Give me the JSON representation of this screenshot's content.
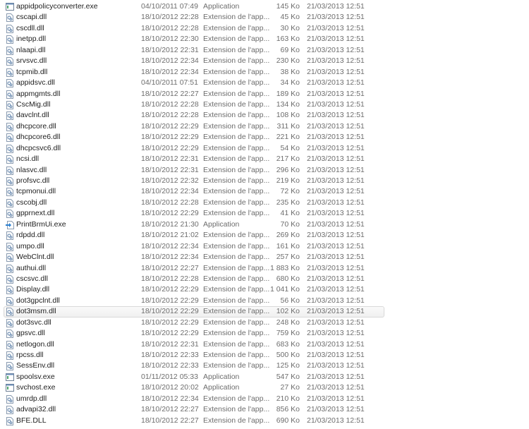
{
  "selected_index": 28,
  "files": [
    {
      "name": "appidpolicyconverter.exe",
      "date": "04/10/2011 07:49",
      "type": "Application",
      "size": "145 Ko",
      "modified": "21/03/2013 12:51",
      "icon": "exe-icon"
    },
    {
      "name": "cscapi.dll",
      "date": "18/10/2012 22:28",
      "type": "Extension de l'app...",
      "size": "45 Ko",
      "modified": "21/03/2013 12:51",
      "icon": "dll-icon"
    },
    {
      "name": "cscdll.dll",
      "date": "18/10/2012 22:28",
      "type": "Extension de l'app...",
      "size": "30 Ko",
      "modified": "21/03/2013 12:51",
      "icon": "dll-icon"
    },
    {
      "name": "inetpp.dll",
      "date": "18/10/2012 22:30",
      "type": "Extension de l'app...",
      "size": "163 Ko",
      "modified": "21/03/2013 12:51",
      "icon": "dll-icon"
    },
    {
      "name": "nlaapi.dll",
      "date": "18/10/2012 22:31",
      "type": "Extension de l'app...",
      "size": "69 Ko",
      "modified": "21/03/2013 12:51",
      "icon": "dll-icon"
    },
    {
      "name": "srvsvc.dll",
      "date": "18/10/2012 22:34",
      "type": "Extension de l'app...",
      "size": "230 Ko",
      "modified": "21/03/2013 12:51",
      "icon": "dll-icon"
    },
    {
      "name": "tcpmib.dll",
      "date": "18/10/2012 22:34",
      "type": "Extension de l'app...",
      "size": "38 Ko",
      "modified": "21/03/2013 12:51",
      "icon": "dll-icon"
    },
    {
      "name": "appidsvc.dll",
      "date": "04/10/2011 07:51",
      "type": "Extension de l'app...",
      "size": "34 Ko",
      "modified": "21/03/2013 12:51",
      "icon": "dll-icon"
    },
    {
      "name": "appmgmts.dll",
      "date": "18/10/2012 22:27",
      "type": "Extension de l'app...",
      "size": "189 Ko",
      "modified": "21/03/2013 12:51",
      "icon": "dll-icon"
    },
    {
      "name": "CscMig.dll",
      "date": "18/10/2012 22:28",
      "type": "Extension de l'app...",
      "size": "134 Ko",
      "modified": "21/03/2013 12:51",
      "icon": "dll-icon"
    },
    {
      "name": "davclnt.dll",
      "date": "18/10/2012 22:28",
      "type": "Extension de l'app...",
      "size": "108 Ko",
      "modified": "21/03/2013 12:51",
      "icon": "dll-icon"
    },
    {
      "name": "dhcpcore.dll",
      "date": "18/10/2012 22:29",
      "type": "Extension de l'app...",
      "size": "311 Ko",
      "modified": "21/03/2013 12:51",
      "icon": "dll-icon"
    },
    {
      "name": "dhcpcore6.dll",
      "date": "18/10/2012 22:29",
      "type": "Extension de l'app...",
      "size": "221 Ko",
      "modified": "21/03/2013 12:51",
      "icon": "dll-icon"
    },
    {
      "name": "dhcpcsvc6.dll",
      "date": "18/10/2012 22:29",
      "type": "Extension de l'app...",
      "size": "54 Ko",
      "modified": "21/03/2013 12:51",
      "icon": "dll-icon"
    },
    {
      "name": "ncsi.dll",
      "date": "18/10/2012 22:31",
      "type": "Extension de l'app...",
      "size": "217 Ko",
      "modified": "21/03/2013 12:51",
      "icon": "dll-icon"
    },
    {
      "name": "nlasvc.dll",
      "date": "18/10/2012 22:31",
      "type": "Extension de l'app...",
      "size": "296 Ko",
      "modified": "21/03/2013 12:51",
      "icon": "dll-icon"
    },
    {
      "name": "profsvc.dll",
      "date": "18/10/2012 22:32",
      "type": "Extension de l'app...",
      "size": "219 Ko",
      "modified": "21/03/2013 12:51",
      "icon": "dll-icon"
    },
    {
      "name": "tcpmonui.dll",
      "date": "18/10/2012 22:34",
      "type": "Extension de l'app...",
      "size": "72 Ko",
      "modified": "21/03/2013 12:51",
      "icon": "dll-icon"
    },
    {
      "name": "cscobj.dll",
      "date": "18/10/2012 22:28",
      "type": "Extension de l'app...",
      "size": "235 Ko",
      "modified": "21/03/2013 12:51",
      "icon": "dll-icon"
    },
    {
      "name": "gpprnext.dll",
      "date": "18/10/2012 22:29",
      "type": "Extension de l'app...",
      "size": "41 Ko",
      "modified": "21/03/2013 12:51",
      "icon": "dll-icon"
    },
    {
      "name": "PrintBrmUi.exe",
      "date": "18/10/2012 21:30",
      "type": "Application",
      "size": "70 Ko",
      "modified": "21/03/2013 12:51",
      "icon": "printer-exe-icon"
    },
    {
      "name": "rdpdd.dll",
      "date": "18/10/2012 21:02",
      "type": "Extension de l'app...",
      "size": "269 Ko",
      "modified": "21/03/2013 12:51",
      "icon": "dll-icon"
    },
    {
      "name": "umpo.dll",
      "date": "18/10/2012 22:34",
      "type": "Extension de l'app...",
      "size": "161 Ko",
      "modified": "21/03/2013 12:51",
      "icon": "dll-icon"
    },
    {
      "name": "WebClnt.dll",
      "date": "18/10/2012 22:34",
      "type": "Extension de l'app...",
      "size": "257 Ko",
      "modified": "21/03/2013 12:51",
      "icon": "dll-icon"
    },
    {
      "name": "authui.dll",
      "date": "18/10/2012 22:27",
      "type": "Extension de l'app...",
      "size": "1 883 Ko",
      "modified": "21/03/2013 12:51",
      "icon": "dll-icon"
    },
    {
      "name": "cscsvc.dll",
      "date": "18/10/2012 22:28",
      "type": "Extension de l'app...",
      "size": "680 Ko",
      "modified": "21/03/2013 12:51",
      "icon": "dll-icon"
    },
    {
      "name": "Display.dll",
      "date": "18/10/2012 22:29",
      "type": "Extension de l'app...",
      "size": "1 041 Ko",
      "modified": "21/03/2013 12:51",
      "icon": "dll-icon"
    },
    {
      "name": "dot3gpclnt.dll",
      "date": "18/10/2012 22:29",
      "type": "Extension de l'app...",
      "size": "56 Ko",
      "modified": "21/03/2013 12:51",
      "icon": "dll-icon"
    },
    {
      "name": "dot3msm.dll",
      "date": "18/10/2012 22:29",
      "type": "Extension de l'app...",
      "size": "102 Ko",
      "modified": "21/03/2013 12:51",
      "icon": "dll-icon"
    },
    {
      "name": "dot3svc.dll",
      "date": "18/10/2012 22:29",
      "type": "Extension de l'app...",
      "size": "248 Ko",
      "modified": "21/03/2013 12:51",
      "icon": "dll-icon"
    },
    {
      "name": "gpsvc.dll",
      "date": "18/10/2012 22:29",
      "type": "Extension de l'app...",
      "size": "759 Ko",
      "modified": "21/03/2013 12:51",
      "icon": "dll-icon"
    },
    {
      "name": "netlogon.dll",
      "date": "18/10/2012 22:31",
      "type": "Extension de l'app...",
      "size": "683 Ko",
      "modified": "21/03/2013 12:51",
      "icon": "dll-icon"
    },
    {
      "name": "rpcss.dll",
      "date": "18/10/2012 22:33",
      "type": "Extension de l'app...",
      "size": "500 Ko",
      "modified": "21/03/2013 12:51",
      "icon": "dll-icon"
    },
    {
      "name": "SessEnv.dll",
      "date": "18/10/2012 22:33",
      "type": "Extension de l'app...",
      "size": "125 Ko",
      "modified": "21/03/2013 12:51",
      "icon": "dll-icon"
    },
    {
      "name": "spoolsv.exe",
      "date": "01/11/2012 05:33",
      "type": "Application",
      "size": "547 Ko",
      "modified": "21/03/2013 12:51",
      "icon": "exe-icon"
    },
    {
      "name": "svchost.exe",
      "date": "18/10/2012 20:02",
      "type": "Application",
      "size": "27 Ko",
      "modified": "21/03/2013 12:51",
      "icon": "exe-icon"
    },
    {
      "name": "umrdp.dll",
      "date": "18/10/2012 22:34",
      "type": "Extension de l'app...",
      "size": "210 Ko",
      "modified": "21/03/2013 12:51",
      "icon": "dll-icon"
    },
    {
      "name": "advapi32.dll",
      "date": "18/10/2012 22:27",
      "type": "Extension de l'app...",
      "size": "856 Ko",
      "modified": "21/03/2013 12:51",
      "icon": "dll-icon"
    },
    {
      "name": "BFE.DLL",
      "date": "18/10/2012 22:27",
      "type": "Extension de l'app...",
      "size": "690 Ko",
      "modified": "21/03/2013 12:51",
      "icon": "dll-icon"
    }
  ]
}
